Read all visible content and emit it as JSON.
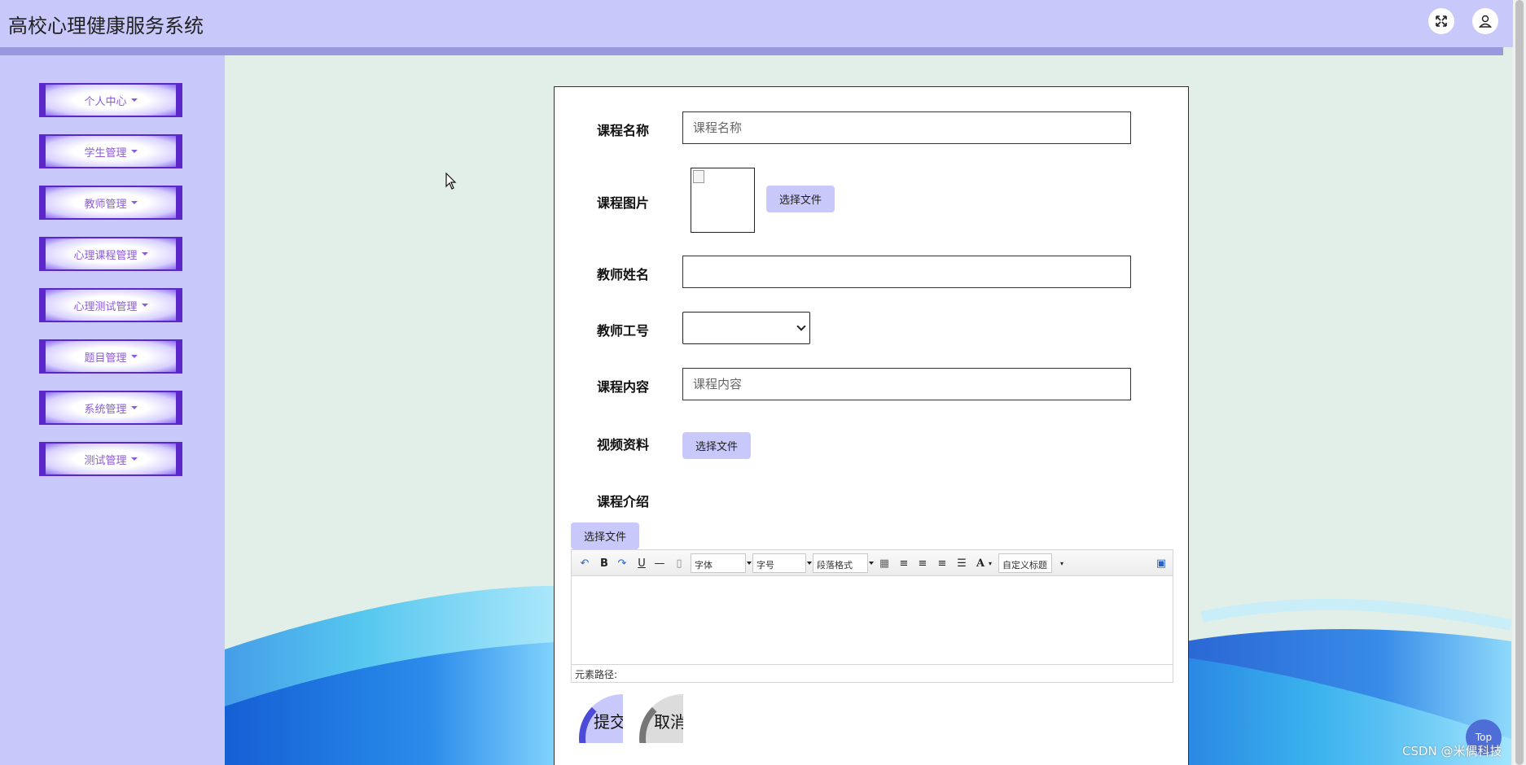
{
  "header": {
    "title": "高校心理健康服务系统",
    "fullscreen_icon": "expand-icon",
    "user_icon": "user-icon"
  },
  "sidebar": {
    "items": [
      {
        "label": "个人中心"
      },
      {
        "label": "学生管理"
      },
      {
        "label": "教师管理"
      },
      {
        "label": "心理课程管理"
      },
      {
        "label": "心理测试管理"
      },
      {
        "label": "题目管理"
      },
      {
        "label": "系统管理"
      },
      {
        "label": "测试管理"
      }
    ]
  },
  "form": {
    "course_name_label": "课程名称",
    "course_name_placeholder": "课程名称",
    "course_image_label": "课程图片",
    "choose_file_label": "选择文件",
    "teacher_name_label": "教师姓名",
    "teacher_id_label": "教师工号",
    "course_content_label": "课程内容",
    "course_content_placeholder": "课程内容",
    "video_label": "视频资料",
    "intro_label": "课程介绍",
    "editor": {
      "font_label": "字体",
      "size_label": "字号",
      "paragraph_label": "段落格式",
      "custom_title_label": "自定义标题",
      "font_color_label": "A",
      "bold_label": "B",
      "underline_label": "U",
      "path_label": "元素路径:"
    },
    "submit_label": "提交",
    "cancel_label": "取消"
  },
  "floating": {
    "top_label": "Top",
    "watermark": "CSDN @米偶科技"
  },
  "colors": {
    "header_bg": "#c8c8fa",
    "menu_accent": "#5b27c9",
    "main_bg": "#e2efe8",
    "button_bg": "#c8c8fa"
  }
}
